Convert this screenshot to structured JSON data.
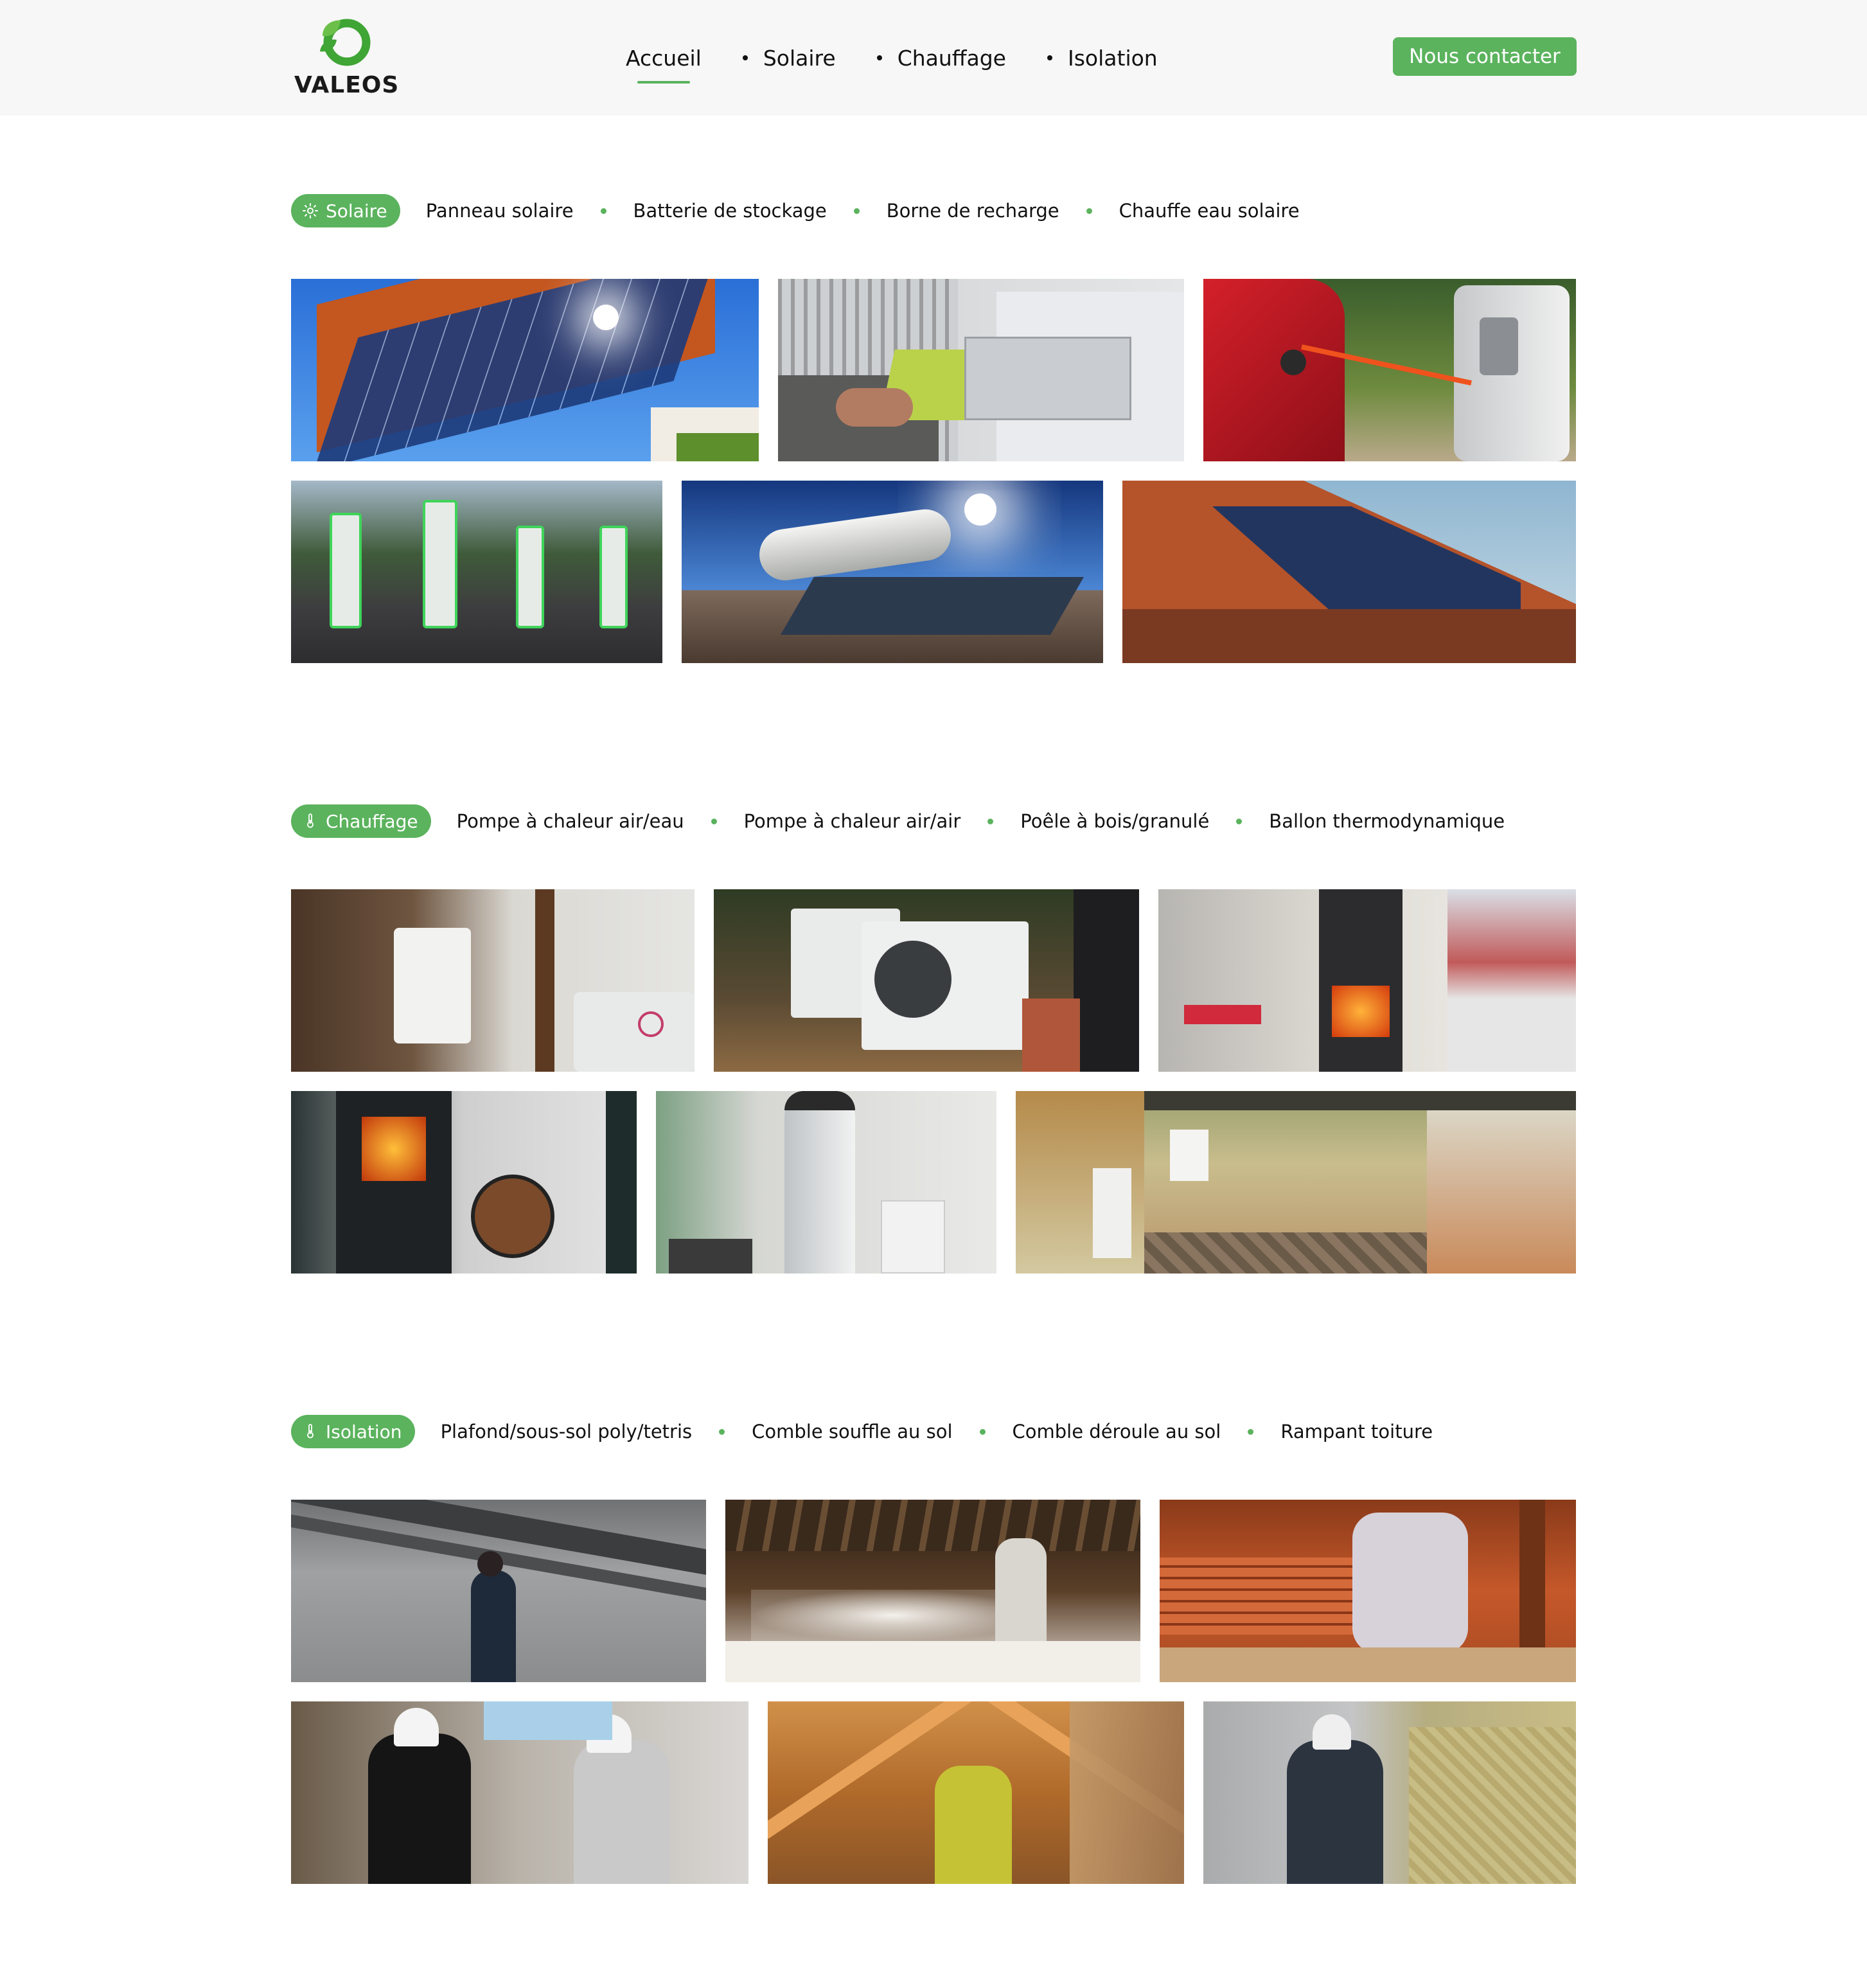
{
  "header": {
    "logo_text": "VALEOS",
    "nav": [
      "Accueil",
      "Solaire",
      "Chauffage",
      "Isolation"
    ],
    "active_nav": "Accueil",
    "contact_label": "Nous contacter"
  },
  "colors": {
    "accent": "#5bb35d",
    "header_bg": "#f7f7f7",
    "text": "#111111"
  },
  "solaire": {
    "pill": "Solaire",
    "pill_icon": "sun-icon",
    "items": [
      "Panneau solaire",
      "Batterie de stockage",
      "Borne de recharge",
      "Chauffe eau solaire"
    ]
  },
  "chauffage": {
    "pill": "Chauffage",
    "pill_icon": "thermometer-icon",
    "items": [
      "Pompe à chaleur air/eau",
      "Pompe à chaleur air/air",
      "Poêle à bois/granulé",
      "Ballon thermodynamique"
    ]
  },
  "isolation": {
    "pill": "Isolation",
    "pill_icon": "thermometer-icon",
    "items": [
      "Plafond/sous-sol poly/tetris",
      "Comble souffle au sol",
      "Comble déroule au sol",
      "Rampant toiture"
    ]
  }
}
